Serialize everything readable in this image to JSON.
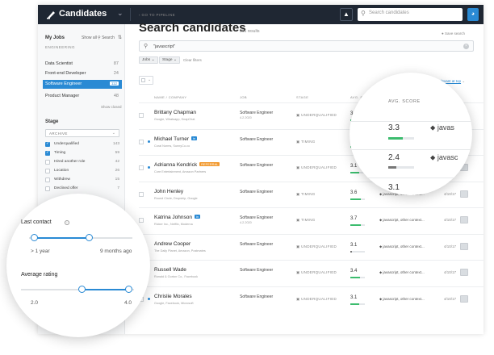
{
  "topbar": {
    "title": "Candidates",
    "search_placeholder": "Search candidates"
  },
  "sidebar": {
    "heading": "My Jobs",
    "show_all": "Show all",
    "search": "Search",
    "group": "ENGINEERING",
    "jobs": [
      {
        "label": "Data Scientist",
        "count": "87"
      },
      {
        "label": "Front-end Developer",
        "count": "24"
      },
      {
        "label": "Software Engineer",
        "count": "112"
      },
      {
        "label": "Product Manager",
        "count": "48"
      }
    ],
    "show_closed": "Show closed",
    "stage_heading": "Stage",
    "stage_select": "ARCHIVE",
    "stages": [
      {
        "label": "Underqualified",
        "count": "143",
        "checked": true
      },
      {
        "label": "Timing",
        "count": "59",
        "checked": true
      },
      {
        "label": "Hired another role",
        "count": "42",
        "checked": false
      },
      {
        "label": "Location",
        "count": "26",
        "checked": false
      },
      {
        "label": "Withdrew",
        "count": "15",
        "checked": false
      },
      {
        "label": "Declined offer",
        "count": "7",
        "checked": false
      }
    ]
  },
  "main": {
    "crumb": "‹ GO TO PIPELINE",
    "title": "Search candidates",
    "results": "366 results",
    "save_search": "Save search",
    "query": "\"javascript\"",
    "chips": [
      "Jobs",
      "Stage"
    ],
    "clear_filters": "Clear filters",
    "sort_label": "Sort by",
    "sort_value": "relevant at top",
    "headers": {
      "name": "NAME / COMPANY",
      "job": "JOB",
      "stage": "STAGE",
      "score": "AVG. SCORE"
    },
    "rows": [
      {
        "name": "Brittany Chapman",
        "sub": "Google, Whatsapp, SnapChat",
        "tag": "",
        "dot": false,
        "job": "Software Engineer",
        "job_sub": "4.2.2020",
        "stage": "UNDERQUALIFIED",
        "score": "3.3",
        "score_level": 0.66,
        "skills": "javascript, other context...",
        "date": "4/10/17"
      },
      {
        "name": "Michael Turner",
        "sub": "Coral Norms, SunnyCo.co",
        "tag": "in",
        "dot": true,
        "job": "Software Engineer",
        "job_sub": "",
        "stage": "TIMING",
        "score": "2.4",
        "score_level": 0.48,
        "skills": "javascript, other context...",
        "date": "4/10/17"
      },
      {
        "name": "Adrianna Kendrick",
        "sub": "Core Entertainment, Amazon Partners",
        "tag": "REFERRAL",
        "dot": true,
        "job": "Software Engineer",
        "job_sub": "",
        "stage": "UNDERQUALIFIED",
        "score": "3.1",
        "score_level": 0.62,
        "skills": "javascript, other context...",
        "date": "4/10/17"
      },
      {
        "name": "John Henley",
        "sub": "Round Circle, Dropship, Google",
        "tag": "",
        "dot": false,
        "job": "Software Engineer",
        "job_sub": "",
        "stage": "TIMING",
        "score": "3.6",
        "score_level": 0.72,
        "skills": "javascript, other context...",
        "date": "4/10/17"
      },
      {
        "name": "Katrina Johnson",
        "sub": "Ricker Inc., Netflix, Moderna",
        "tag": "in",
        "dot": false,
        "job": "Software Engineer",
        "job_sub": "4.2.2020",
        "stage": "TIMING",
        "score": "3.7",
        "score_level": 0.74,
        "skills": "javascript, other context...",
        "date": "4/10/17"
      },
      {
        "name": "Andrew Cooper",
        "sub": "The Daily Planet, Amazon, Postmates",
        "tag": "",
        "dot": false,
        "job": "Software Engineer",
        "job_sub": "",
        "stage": "UNDERQUALIFIED",
        "score": "3.1",
        "score_level": 0.1,
        "skills": "javascript, other context...",
        "date": "4/10/17"
      },
      {
        "name": "Russell Wade",
        "sub": "Ronald & Gorton Co., Facebook",
        "tag": "",
        "dot": false,
        "job": "Software Engineer",
        "job_sub": "",
        "stage": "UNDERQUALIFIED",
        "score": "3.4",
        "score_level": 0.68,
        "skills": "javascript, other context...",
        "date": "4/10/17"
      },
      {
        "name": "Chrislie Morales",
        "sub": "Google, Facebook, Microsoft",
        "tag": "",
        "dot": true,
        "job": "Software Engineer",
        "job_sub": "",
        "stage": "UNDERQUALIFIED",
        "score": "3.1",
        "score_level": 0.62,
        "skills": "javascript, other context...",
        "date": "4/10/17"
      }
    ]
  },
  "magnifier": {
    "header": "AVG. SCORE",
    "stage": "STAGE",
    "rows": [
      {
        "score": "3.3",
        "skill": "javas",
        "level": 0.55,
        "color": "#3cbc6e"
      },
      {
        "score": "2.4",
        "skill": "javasc",
        "level": 0.3,
        "color": "#777777"
      },
      {
        "score": "3.1",
        "skill": "",
        "level": 0,
        "color": "#3cbc6e"
      }
    ]
  },
  "filters": {
    "last_contact_label": "Last contact",
    "last_contact_min": "> 1 year",
    "last_contact_max": "9 months ago",
    "avg_rating_label": "Average rating",
    "avg_rating_min": "2.0",
    "avg_rating_max": "4.0"
  },
  "colors": {
    "accent": "#2a8ad4",
    "topbar": "#1f2733",
    "good": "#3cbc6e"
  }
}
